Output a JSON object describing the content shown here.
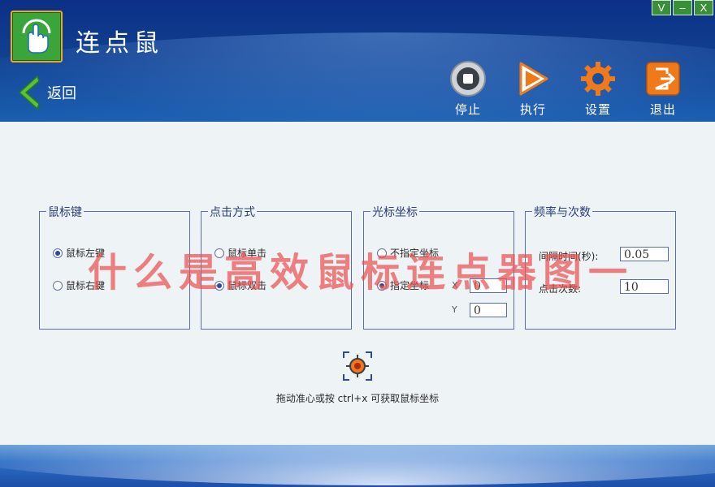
{
  "app": {
    "title": "连点鼠"
  },
  "window_controls": {
    "v": "V",
    "min": "–",
    "close": "X"
  },
  "back": {
    "label": "返回"
  },
  "toolbar": {
    "stop": "停止",
    "run": "执行",
    "settings": "设置",
    "exit": "退出"
  },
  "groups": {
    "mouse_key": {
      "legend": "鼠标键",
      "options": [
        "鼠标左键",
        "鼠标右键"
      ],
      "selected": 0
    },
    "click_mode": {
      "legend": "点击方式",
      "options": [
        "鼠标单击",
        "鼠标双击"
      ],
      "selected": 1
    },
    "cursor_pos": {
      "legend": "光标坐标",
      "options": [
        "不指定坐标",
        "指定坐标"
      ],
      "selected": 1,
      "x_label": "X",
      "y_label": "Y",
      "x_value": "0",
      "y_value": "0"
    },
    "freq": {
      "legend": "频率与次数",
      "interval_label": "间隔时间(秒):",
      "interval_value": "0.05",
      "count_label": "点击次数:",
      "count_value": "10"
    }
  },
  "hint": "拖动准心或按 ctrl+x 可获取鼠标坐标",
  "watermark": "什么是高效鼠标连点器图一",
  "colors": {
    "header": "#11408f",
    "logo_bg": "#3aa53a",
    "accent_orange": "#f07a1a",
    "border": "#5a6fa8",
    "watermark": "#eb5050"
  }
}
